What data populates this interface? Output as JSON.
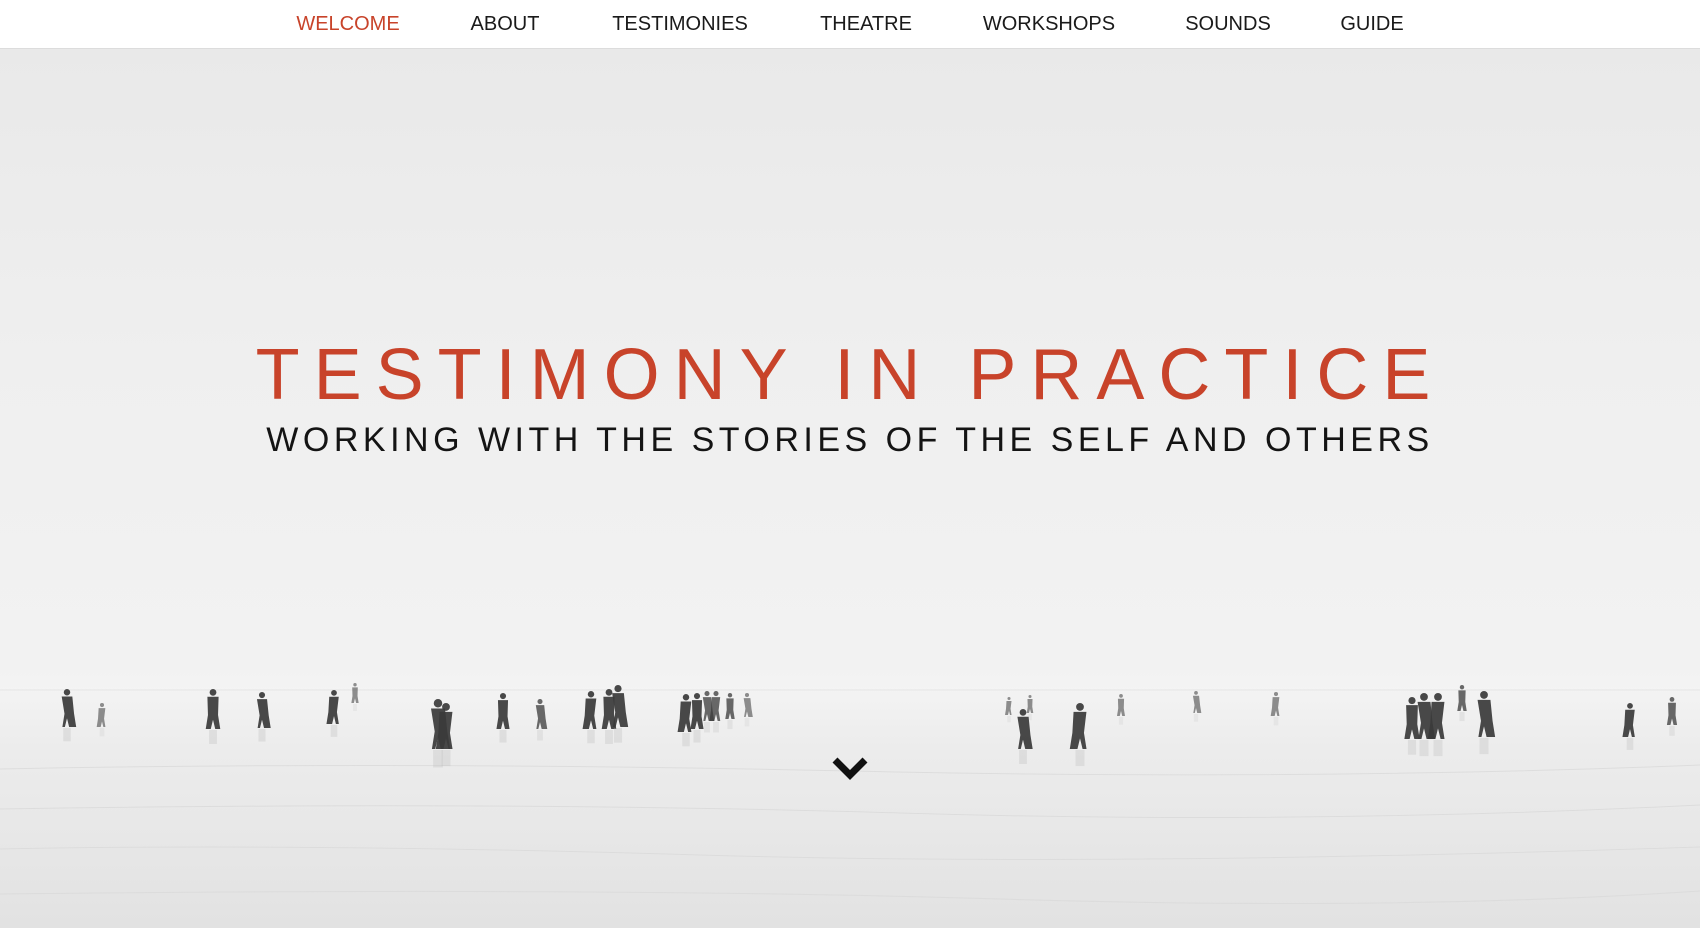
{
  "nav": {
    "items": [
      {
        "label": "WELCOME",
        "active": true
      },
      {
        "label": "ABOUT",
        "active": false
      },
      {
        "label": "TESTIMONIES",
        "active": false
      },
      {
        "label": "THEATRE",
        "active": false
      },
      {
        "label": "WORKSHOPS",
        "active": false
      },
      {
        "label": "SOUNDS",
        "active": false
      },
      {
        "label": "GUIDE",
        "active": false
      }
    ]
  },
  "hero": {
    "title": "TESTIMONY IN PRACTICE",
    "subtitle": "WORKING WITH THE STORIES OF THE SELF AND OTHERS",
    "scroll_icon": "chevron-down-icon"
  },
  "colors": {
    "accent": "#c8432a",
    "text": "#141414",
    "nav_bg": "#ffffff",
    "hero_bg": "#efefef"
  }
}
